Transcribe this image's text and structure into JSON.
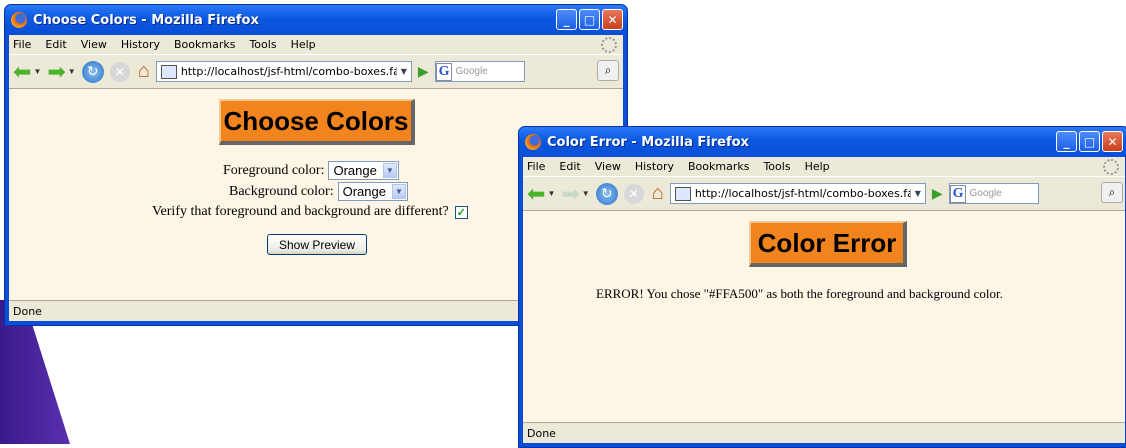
{
  "browser": {
    "menu": [
      "File",
      "Edit",
      "View",
      "History",
      "Bookmarks",
      "Tools",
      "Help"
    ],
    "url": "http://localhost/jsf-html/combo-boxes.faces",
    "search_placeholder": "Google",
    "status": "Done"
  },
  "window1": {
    "title": "Choose Colors - Mozilla Firefox",
    "heading": "Choose Colors",
    "foreground_label": "Foreground color:",
    "foreground_value": "Orange",
    "background_label": "Background color:",
    "background_value": "Orange",
    "verify_label": "Verify that foreground and background are different?",
    "verify_checked": true,
    "preview_button": "Show Preview"
  },
  "window2": {
    "title": "Color Error - Mozilla Firefox",
    "heading": "Color Error",
    "message": "ERROR! You chose \"#FFA500\" as both the foreground and background color."
  },
  "colors": {
    "heading_bg": "#F2841E",
    "content_bg": "#FDF5E6",
    "titlebar": "#0A4ED6"
  },
  "icons": {
    "window_controls": [
      "minimize-icon",
      "maximize-icon",
      "close-icon"
    ],
    "nav": [
      "back-icon",
      "forward-icon",
      "reload-icon",
      "stop-icon",
      "home-icon",
      "go-icon",
      "search-icon"
    ]
  }
}
